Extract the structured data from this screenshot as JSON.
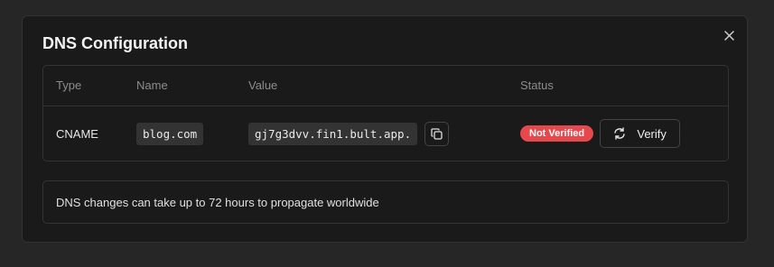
{
  "dialog": {
    "title": "DNS Configuration",
    "close_icon": "close-icon"
  },
  "table": {
    "headers": {
      "type": "Type",
      "name": "Name",
      "value": "Value",
      "status": "Status"
    },
    "rows": [
      {
        "type": "CNAME",
        "name": "blog.com",
        "value": "gj7g3dvv.fin1.bult.app.",
        "copy_icon": "copy-icon",
        "status": "Not Verified",
        "verify_label": "Verify",
        "verify_icon": "refresh-icon"
      }
    ]
  },
  "note": {
    "text": "DNS changes can take up to 72 hours to propagate worldwide"
  },
  "colors": {
    "background": "#262626",
    "dialog": "#1a1a1a",
    "border": "#333333",
    "status_error": "#e5484d"
  }
}
